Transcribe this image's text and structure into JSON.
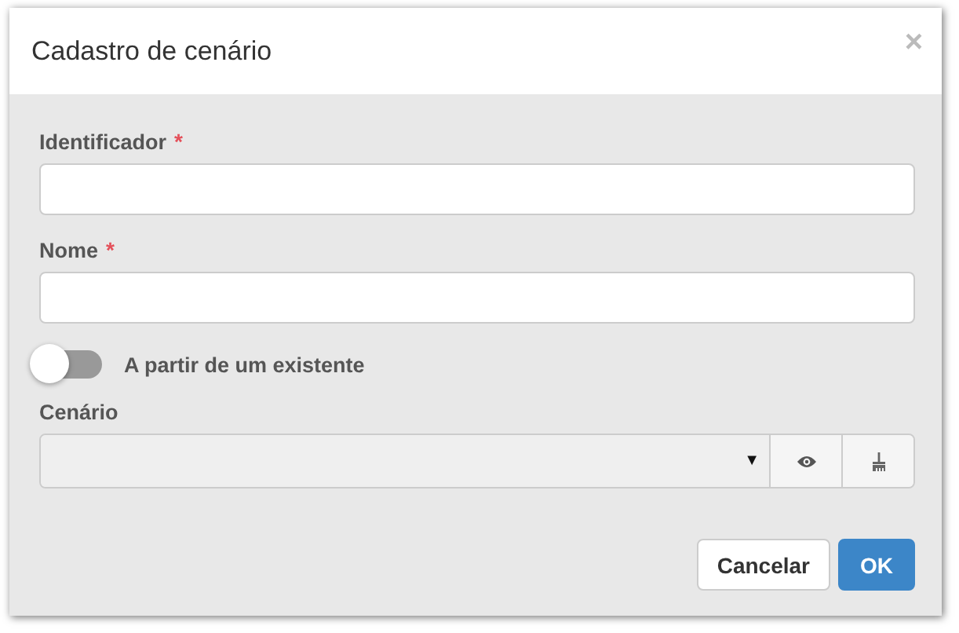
{
  "dialog": {
    "title": "Cadastro de cenário",
    "close": "×"
  },
  "fields": [
    {
      "label": "Identificador",
      "required_mark": "*"
    },
    {
      "label": "Nome",
      "required_mark": "*"
    }
  ],
  "toggle": {
    "label": "A partir de um existente",
    "on": false
  },
  "scenario": {
    "label": "Cenário",
    "caret": "▼"
  },
  "buttons": [
    {
      "label": "Cancelar",
      "kind": "default"
    },
    {
      "label": "OK",
      "kind": "primary"
    }
  ]
}
